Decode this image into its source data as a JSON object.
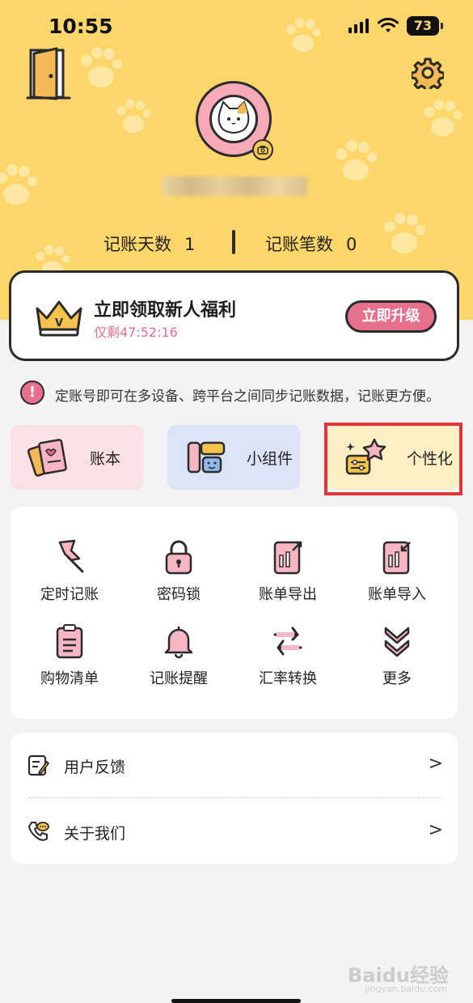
{
  "status_bar": {
    "time": "10:55",
    "battery": "73"
  },
  "profile": {
    "stats": [
      {
        "label": "记账天数",
        "value": "1"
      },
      {
        "label": "记账笔数",
        "value": "0"
      }
    ]
  },
  "promo": {
    "title": "立即领取新人福利",
    "countdown": "仅剩47:52:16",
    "button_label": "立即升级"
  },
  "notice": {
    "text": "定账号即可在多设备、跨平台之间同步记账数据，记账更方便。"
  },
  "tiles": [
    {
      "label": "账本",
      "icon": "ledger-icon"
    },
    {
      "label": "小组件",
      "icon": "widget-icon"
    },
    {
      "label": "个性化",
      "icon": "personalize-icon"
    }
  ],
  "grid": {
    "items": [
      {
        "label": "定时记账",
        "icon": "pin-icon"
      },
      {
        "label": "密码锁",
        "icon": "lock-icon"
      },
      {
        "label": "账单导出",
        "icon": "export-icon"
      },
      {
        "label": "账单导入",
        "icon": "import-icon"
      },
      {
        "label": "购物清单",
        "icon": "clipboard-icon"
      },
      {
        "label": "记账提醒",
        "icon": "bell-icon"
      },
      {
        "label": "汇率转换",
        "icon": "exchange-icon"
      },
      {
        "label": "更多",
        "icon": "more-icon"
      }
    ]
  },
  "list": {
    "items": [
      {
        "label": "用户反馈",
        "icon": "feedback-icon"
      },
      {
        "label": "关于我们",
        "icon": "phone-icon"
      }
    ]
  },
  "colors": {
    "header_yellow": "#fcd66b",
    "accent_pink": "#e8708f",
    "highlight_red": "#e2323a"
  },
  "watermark": {
    "brand": "Baidu经验",
    "url": "jingyan.baidu.com"
  }
}
